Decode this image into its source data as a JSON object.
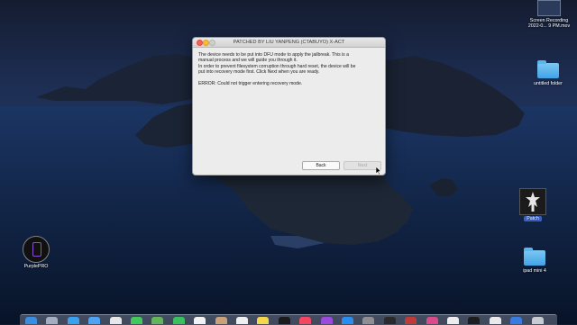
{
  "desktop": {
    "icons": [
      {
        "key": "screen_recording",
        "label_line1": "Screen Recording",
        "label_line2": "2022-0... 9 PM.mov"
      },
      {
        "key": "untitled_folder",
        "label": "untitled folder"
      },
      {
        "key": "patch",
        "label": "Patch"
      },
      {
        "key": "ipad_mini_4",
        "label": "ipad mini 4"
      },
      {
        "key": "purplepro",
        "label": "PurplePRO"
      }
    ]
  },
  "dialog": {
    "title": "PATCHED BY LIU YANPENG (CTABUYO) X-ACT",
    "message_lines": [
      "The device needs to be put into DFU mode to apply the jailbreak. This is a",
      "manual process and we will guide you through it.",
      "In order to prevent filesystem corruption through hard reset, the device will be",
      "put into recovery mode first. Click Next when you are ready."
    ],
    "error": "ERROR: Could not trigger entering recovery mode.",
    "buttons": {
      "back": "Back",
      "next": "Next"
    }
  },
  "dock": {
    "apps": [
      {
        "name": "finder",
        "color": "#3b8de0"
      },
      {
        "name": "launchpad",
        "color": "#a5aec0"
      },
      {
        "name": "safari",
        "color": "#3aa0f0"
      },
      {
        "name": "mail",
        "color": "#4ea3f2"
      },
      {
        "name": "photos",
        "color": "#e7e7e7"
      },
      {
        "name": "messages",
        "color": "#42c95a"
      },
      {
        "name": "maps",
        "color": "#63b45a"
      },
      {
        "name": "facetime",
        "color": "#3ac15e"
      },
      {
        "name": "calendar",
        "color": "#f2f2f2"
      },
      {
        "name": "contacts",
        "color": "#c9a27a"
      },
      {
        "name": "reminders",
        "color": "#efefef"
      },
      {
        "name": "notes",
        "color": "#f6d64a"
      },
      {
        "name": "tv",
        "color": "#1b1b1b"
      },
      {
        "name": "music",
        "color": "#f44561"
      },
      {
        "name": "podcasts",
        "color": "#9b4bdc"
      },
      {
        "name": "app-store",
        "color": "#2a8df0"
      },
      {
        "name": "system-preferences",
        "color": "#8e8e93"
      },
      {
        "name": "terminal",
        "color": "#2a2a2a"
      },
      {
        "name": "app-1",
        "color": "#c03a3a"
      },
      {
        "name": "app-2",
        "color": "#d94b8a"
      },
      {
        "name": "app-3",
        "color": "#ededed"
      },
      {
        "name": "app-4",
        "color": "#1d1d1d"
      },
      {
        "name": "app-5",
        "color": "#eaeaea"
      },
      {
        "name": "app-6",
        "color": "#3a7be0"
      },
      {
        "name": "trash",
        "color": "#c7cbd2"
      }
    ]
  }
}
